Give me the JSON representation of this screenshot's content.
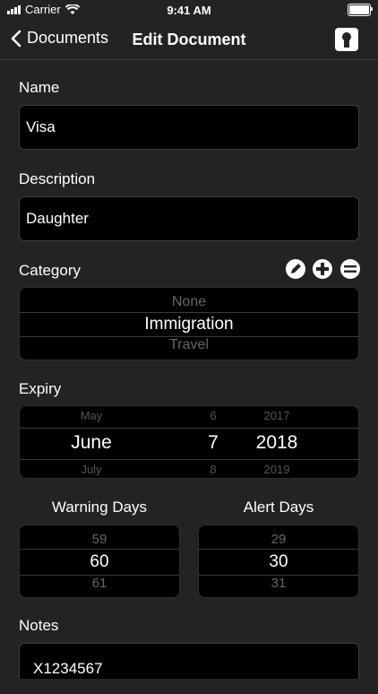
{
  "status_bar": {
    "carrier": "Carrier",
    "time": "9:41 AM"
  },
  "nav": {
    "back_label": "Documents",
    "title": "Edit Document"
  },
  "name": {
    "label": "Name",
    "value": "Visa"
  },
  "description": {
    "label": "Description",
    "value": "Daughter"
  },
  "category": {
    "label": "Category",
    "options_above": "None",
    "selected": "Immigration",
    "options_below": "Travel"
  },
  "expiry": {
    "label": "Expiry",
    "month": {
      "above": "May",
      "selected": "June",
      "below": "July"
    },
    "day": {
      "above": "6",
      "selected": "7",
      "below": "8"
    },
    "year": {
      "above": "2017",
      "selected": "2018",
      "below": "2019"
    }
  },
  "warning_days": {
    "label": "Warning Days",
    "above": "59",
    "selected": "60",
    "below": "61"
  },
  "alert_days": {
    "label": "Alert Days",
    "above": "29",
    "selected": "30",
    "below": "31"
  },
  "notes": {
    "label": "Notes",
    "value": "X1234567"
  }
}
